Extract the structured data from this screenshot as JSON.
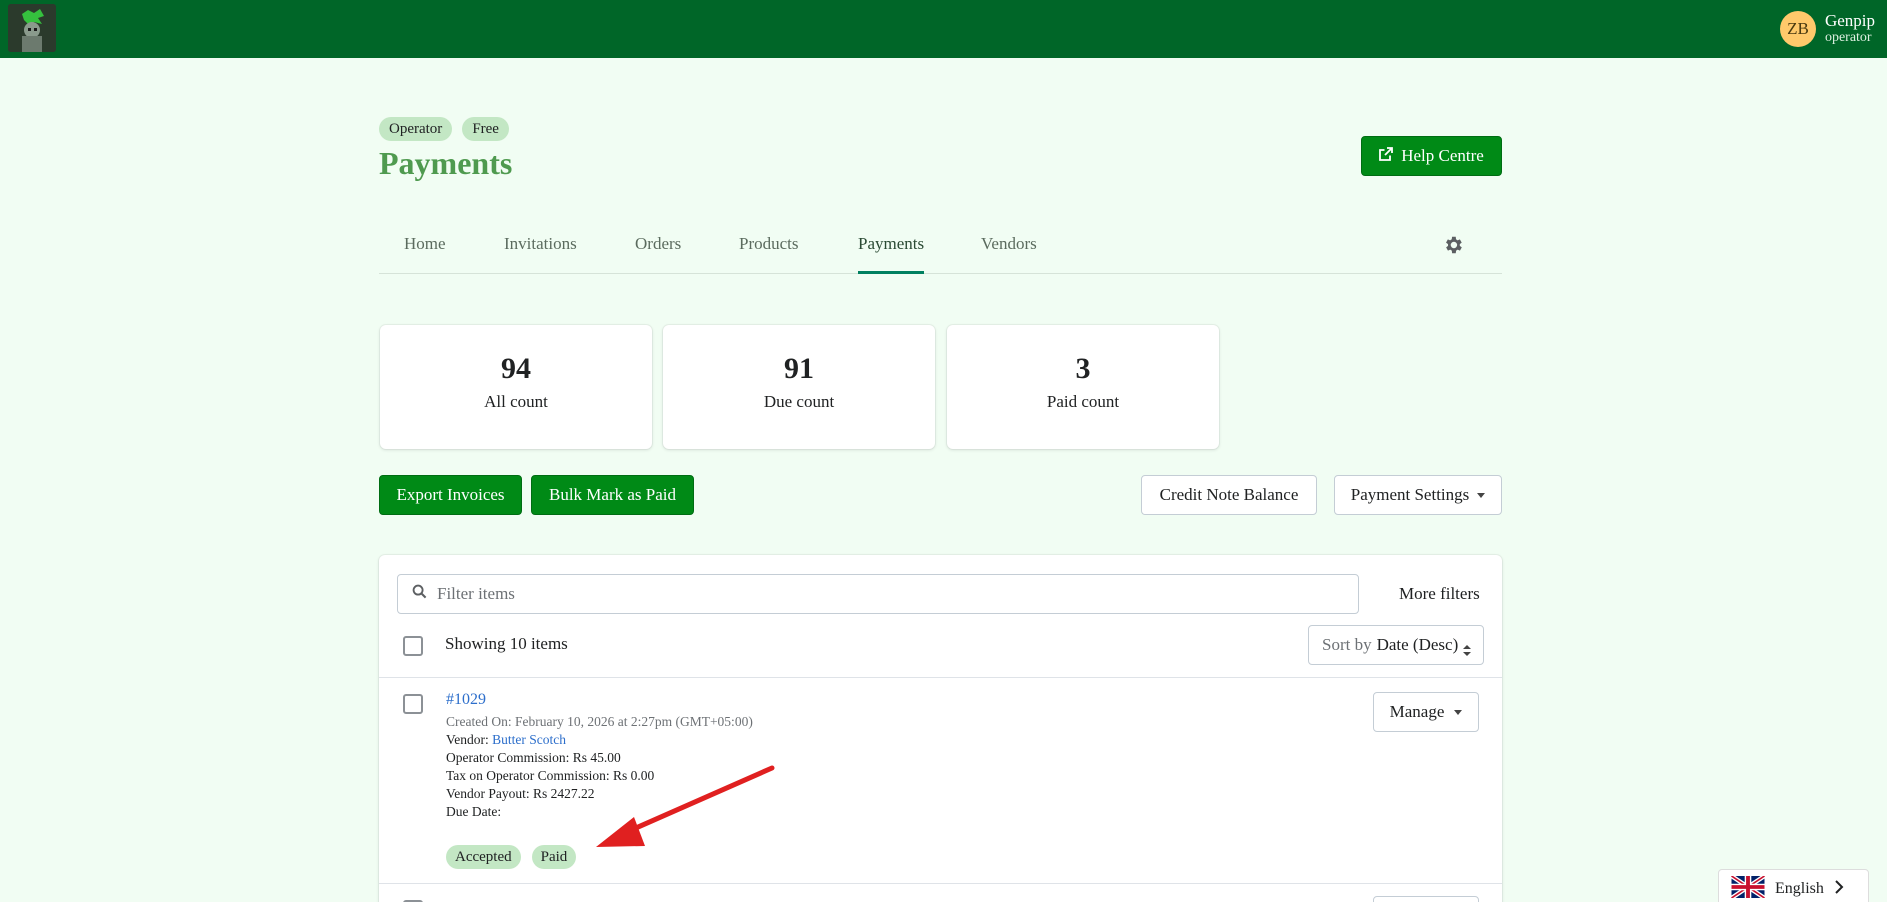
{
  "user": {
    "initials": "ZB",
    "name": "Genpip",
    "role": "operator"
  },
  "header": {
    "badges": [
      "Operator",
      "Free"
    ],
    "title": "Payments",
    "help_label": "Help Centre"
  },
  "tabs": [
    {
      "label": "Home"
    },
    {
      "label": "Invitations"
    },
    {
      "label": "Orders"
    },
    {
      "label": "Products"
    },
    {
      "label": "Payments",
      "active": true
    },
    {
      "label": "Vendors"
    }
  ],
  "stats": [
    {
      "value": "94",
      "label": "All count"
    },
    {
      "value": "91",
      "label": "Due count"
    },
    {
      "value": "3",
      "label": "Paid count"
    }
  ],
  "actions": {
    "export_label": "Export Invoices",
    "bulk_label": "Bulk Mark as Paid",
    "credit_label": "Credit Note Balance",
    "settings_label": "Payment Settings"
  },
  "list": {
    "search_placeholder": "Filter items",
    "more_filters": "More filters",
    "showing": "Showing 10 items",
    "sort_prefix": "Sort by",
    "sort_value": "Date (Desc)",
    "item": {
      "id": "#1029",
      "created": "Created On: February 10, 2026 at 2:27pm (GMT+05:00)",
      "vendor_label": "Vendor:",
      "vendor_name": "Butter Scotch",
      "commission": "Operator Commission: Rs 45.00",
      "tax": "Tax on Operator Commission: Rs 0.00",
      "payout": "Vendor Payout: Rs 2427.22",
      "due": "Due Date:",
      "manage_label": "Manage",
      "statuses": [
        "Accepted",
        "Paid"
      ]
    }
  },
  "language": {
    "label": "English"
  },
  "colors": {
    "topbar": "#006628",
    "primary_button": "#008a16",
    "title": "#4f9a4f",
    "badge": "#c3e7c4",
    "link": "#2c6ecb",
    "annotation_arrow": "#e02020"
  }
}
